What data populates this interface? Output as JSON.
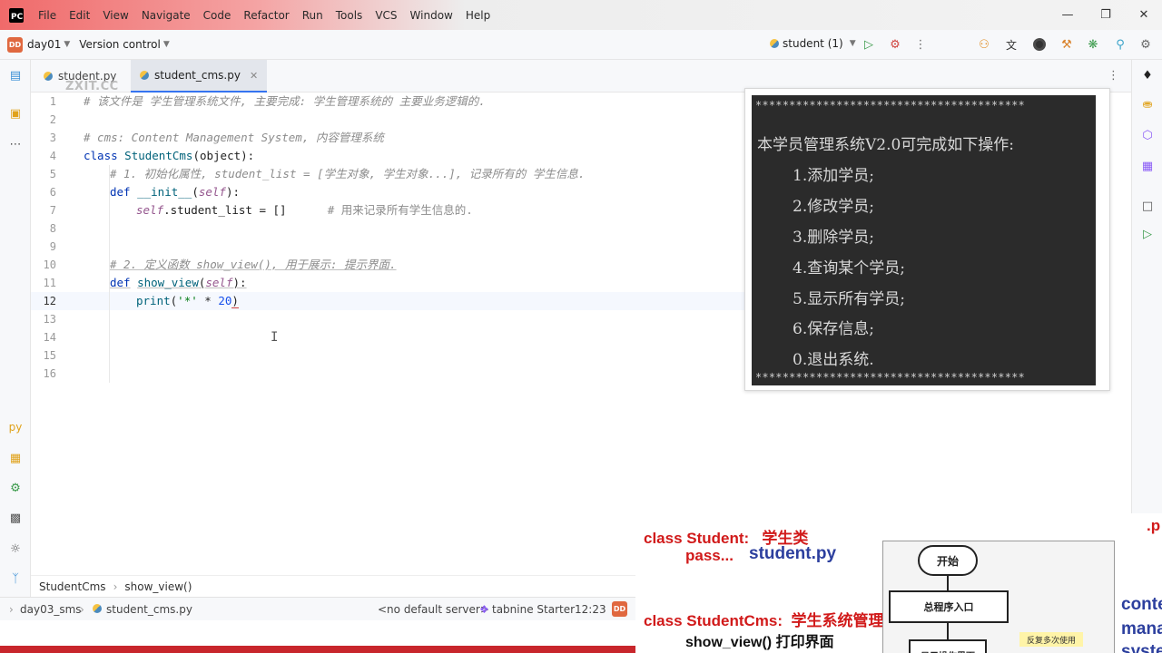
{
  "menubar": {
    "logo": "PC",
    "items": [
      "File",
      "Edit",
      "View",
      "Navigate",
      "Code",
      "Refactor",
      "Run",
      "Tools",
      "VCS",
      "Window",
      "Help"
    ]
  },
  "toolbar": {
    "project_badge": "DD",
    "project_name": "day01",
    "vcs_label": "Version control",
    "run_config": "student (1)"
  },
  "tabs": [
    {
      "label": "student.py",
      "active": false
    },
    {
      "label": "student_cms.py",
      "active": true
    }
  ],
  "watermark": "ZXIT.CC",
  "editor": {
    "current_line": 12,
    "line_numbers": [
      "1",
      "2",
      "3",
      "4",
      "5",
      "6",
      "7",
      "8",
      "9",
      "10",
      "11",
      "12",
      "13",
      "14",
      "15",
      "16"
    ],
    "lines": {
      "l1": "# 该文件是 学生管理系统文件, 主要完成: 学生管理系统的 主要业务逻辑的.",
      "l3": "# cms: Content Management System, 内容管理系统",
      "l4_kw": "class",
      "l4_name": "StudentCms",
      "l4_rest": "(object):",
      "l5": "# 1. 初始化属性, student_list = [学生对象, 学生对象...], 记录所有的 学生信息.",
      "l6_kw": "def",
      "l6_name": "__init__",
      "l6_self": "self",
      "l6_rest": "):",
      "l7_self": "self",
      "l7_rest": ".student_list = []",
      "l7_comment": "# 用来记录所有学生信息的.",
      "l10": "# 2. 定义函数 show_view(), 用于展示: 提示界面.",
      "l11_kw": "def",
      "l11_name": "show_view",
      "l11_self": "self",
      "l11_rest": "):",
      "l12_fn": "print",
      "l12_str": "'*'",
      "l12_op": " * ",
      "l12_num": "20",
      "l12_close": ")"
    }
  },
  "terminal": {
    "stars": "****************************************",
    "title": "本学员管理系统V2.0可完成如下操作:",
    "items": [
      "1.添加学员;",
      "2.修改学员;",
      "3.删除学员;",
      "4.查询某个学员;",
      "5.显示所有学员;",
      "6.保存信息;",
      "0.退出系统."
    ]
  },
  "breadcrumb": [
    "StudentCms",
    "show_view()"
  ],
  "statusbar": {
    "project": "day03_sms",
    "file": "student_cms.py",
    "server": "<no default server>",
    "plugin": "tabnine Starter",
    "position": "12:23",
    "badge": "DD"
  },
  "slide": {
    "line1_code": "class Student:",
    "line1_cn": "学生类",
    "line2_code": "pass...",
    "line2_file": "student.py",
    "line3_code": "class StudentCms:",
    "line3_cn": "学生系统管理类",
    "line4": "show_view() 打印界面",
    "corner_top": ".p",
    "right_words": [
      "conte",
      "mana",
      "syste"
    ],
    "flow": {
      "start": "开始",
      "entry": "总程序入口",
      "show": "显示操作界面",
      "note": "反复多次使用"
    }
  }
}
